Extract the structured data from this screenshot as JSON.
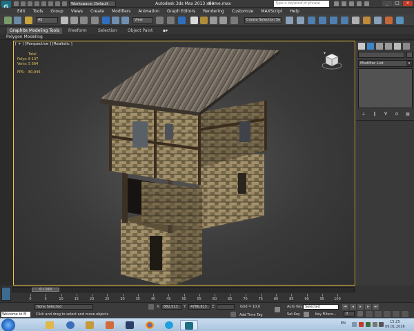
{
  "titlebar": {
    "workspace": "Workspace: Default",
    "app_title": "Autodesk 3ds Max 2013 x64",
    "file_name": "Home.max",
    "search_placeholder": "Type a keyword or phrase",
    "win_min": "_",
    "win_max": "□",
    "win_close": "×"
  },
  "menu": [
    "Edit",
    "Tools",
    "Group",
    "Views",
    "Create",
    "Modifiers",
    "Animation",
    "Graph Editors",
    "Rendering",
    "Customize",
    "MAXScript",
    "Help"
  ],
  "toolbar": {
    "filter": "All",
    "coord_system": "View",
    "named_selection": "Create Selection Se"
  },
  "ribbon": {
    "tabs": [
      "Graphite Modeling Tools",
      "Freeform",
      "Selection",
      "Object Paint"
    ],
    "subtitle": "Polygon Modeling"
  },
  "viewport": {
    "label": "[ + ] [Perspective ] [Realistic ]",
    "stats": {
      "header": "Total",
      "polys_label": "Polys:",
      "polys_value": "8 137",
      "verts_label": "Verts:",
      "verts_value": "5 564",
      "fps_label": "FPS:",
      "fps_value": "80,946"
    }
  },
  "command_panel": {
    "modifier_list": "Modifier List",
    "stack_buttons": [
      "⊥",
      "‖",
      "∀",
      "⊙",
      "▤"
    ]
  },
  "timeline": {
    "frame_display": "0 / 100",
    "ticks": [
      "0",
      "5",
      "10",
      "15",
      "20",
      "25",
      "30",
      "35",
      "40",
      "45",
      "50",
      "55",
      "60",
      "65",
      "70",
      "75",
      "80",
      "85",
      "90",
      "95",
      "100"
    ]
  },
  "status": {
    "welcome": "Welcome to M",
    "selection": "None Selected",
    "prompt": "Click and drag to select and move objects",
    "x_label": "X:",
    "x_value": "882,513",
    "y_label": "Y:",
    "y_value": "4766,813",
    "z_label": "Z:",
    "z_value": "",
    "grid": "Grid = 10,0",
    "add_time_tag": "Add Time Tag",
    "auto_key": "Auto Key",
    "selected": "Selected",
    "set_key": "Set Key",
    "key_filters": "Key Filters...",
    "frame_field": "0"
  },
  "taskbar": {
    "lang": "EN",
    "time": "15:25",
    "date": "09.01.2016"
  },
  "colors": {
    "viewport_border": "#f0c23c",
    "stats_text": "#e8c55a",
    "brand": "#1d6f84"
  }
}
